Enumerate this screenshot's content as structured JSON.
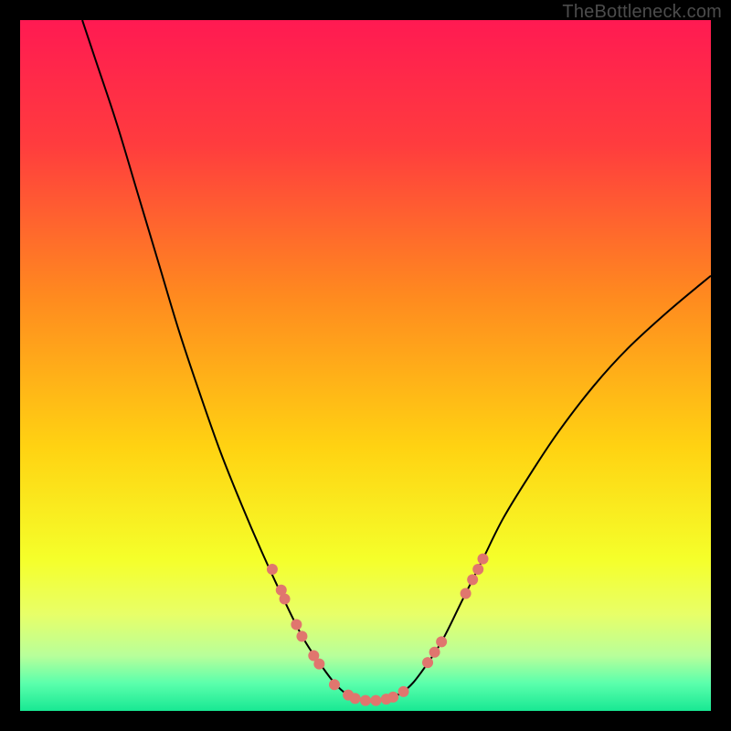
{
  "watermark": "TheBottleneck.com",
  "chart_data": {
    "type": "line",
    "title": "",
    "xlabel": "",
    "ylabel": "",
    "xlim": [
      0,
      100
    ],
    "ylim": [
      0,
      100
    ],
    "gradient_stops": [
      {
        "offset": 0,
        "color": "#ff1a52"
      },
      {
        "offset": 18,
        "color": "#ff3c3e"
      },
      {
        "offset": 40,
        "color": "#ff8a1f"
      },
      {
        "offset": 62,
        "color": "#ffd312"
      },
      {
        "offset": 78,
        "color": "#f5ff2a"
      },
      {
        "offset": 86,
        "color": "#e8ff68"
      },
      {
        "offset": 92,
        "color": "#b8ff9a"
      },
      {
        "offset": 96,
        "color": "#5bffac"
      },
      {
        "offset": 100,
        "color": "#18e893"
      }
    ],
    "series": [
      {
        "name": "curve",
        "type": "line",
        "color": "#000000",
        "stroke_width": 2,
        "points": [
          {
            "x": 9.0,
            "y": 100.0
          },
          {
            "x": 11.0,
            "y": 94.0
          },
          {
            "x": 14.0,
            "y": 85.0
          },
          {
            "x": 17.0,
            "y": 75.0
          },
          {
            "x": 20.0,
            "y": 65.0
          },
          {
            "x": 23.0,
            "y": 55.0
          },
          {
            "x": 26.0,
            "y": 46.0
          },
          {
            "x": 29.0,
            "y": 37.5
          },
          {
            "x": 32.0,
            "y": 30.0
          },
          {
            "x": 35.0,
            "y": 23.0
          },
          {
            "x": 38.0,
            "y": 16.5
          },
          {
            "x": 41.0,
            "y": 10.5
          },
          {
            "x": 44.0,
            "y": 6.0
          },
          {
            "x": 46.0,
            "y": 3.5
          },
          {
            "x": 48.0,
            "y": 2.0
          },
          {
            "x": 50.0,
            "y": 1.5
          },
          {
            "x": 52.0,
            "y": 1.5
          },
          {
            "x": 54.0,
            "y": 2.0
          },
          {
            "x": 56.0,
            "y": 3.2
          },
          {
            "x": 58.0,
            "y": 5.5
          },
          {
            "x": 61.0,
            "y": 10.0
          },
          {
            "x": 64.0,
            "y": 16.0
          },
          {
            "x": 67.0,
            "y": 22.0
          },
          {
            "x": 70.0,
            "y": 28.0
          },
          {
            "x": 74.0,
            "y": 34.5
          },
          {
            "x": 78.0,
            "y": 40.5
          },
          {
            "x": 83.0,
            "y": 47.0
          },
          {
            "x": 88.0,
            "y": 52.5
          },
          {
            "x": 94.0,
            "y": 58.0
          },
          {
            "x": 100.0,
            "y": 63.0
          }
        ]
      },
      {
        "name": "markers",
        "type": "scatter",
        "color": "#e0766e",
        "radius": 6,
        "points": [
          {
            "x": 36.5,
            "y": 20.5
          },
          {
            "x": 37.8,
            "y": 17.5
          },
          {
            "x": 38.3,
            "y": 16.2
          },
          {
            "x": 40.0,
            "y": 12.5
          },
          {
            "x": 40.8,
            "y": 10.8
          },
          {
            "x": 42.5,
            "y": 8.0
          },
          {
            "x": 43.3,
            "y": 6.8
          },
          {
            "x": 45.5,
            "y": 3.8
          },
          {
            "x": 47.5,
            "y": 2.3
          },
          {
            "x": 48.5,
            "y": 1.8
          },
          {
            "x": 50.0,
            "y": 1.5
          },
          {
            "x": 51.5,
            "y": 1.5
          },
          {
            "x": 53.0,
            "y": 1.7
          },
          {
            "x": 54.0,
            "y": 2.0
          },
          {
            "x": 55.5,
            "y": 2.8
          },
          {
            "x": 59.0,
            "y": 7.0
          },
          {
            "x": 60.0,
            "y": 8.5
          },
          {
            "x": 61.0,
            "y": 10.0
          },
          {
            "x": 64.5,
            "y": 17.0
          },
          {
            "x": 65.5,
            "y": 19.0
          },
          {
            "x": 66.3,
            "y": 20.5
          },
          {
            "x": 67.0,
            "y": 22.0
          }
        ]
      }
    ]
  }
}
